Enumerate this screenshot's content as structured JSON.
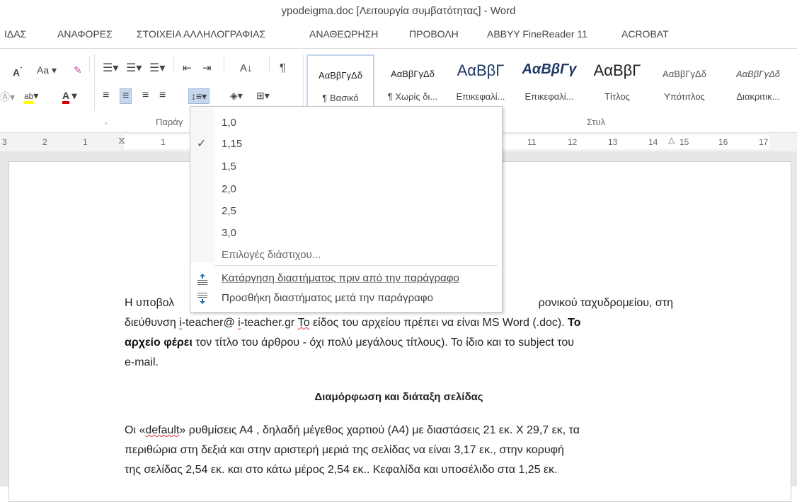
{
  "window": {
    "title": "ypodeigma.doc [Λειτουργία συμβατότητας] - Word"
  },
  "ribbon_tabs": [
    "ΙΔΑΣ",
    "ΑΝΑΦΟΡΕΣ",
    "ΣΤΟΙΧΕΙΑ ΑΛΛΗΛΟΓΡΑΦΙΑΣ",
    "ΑΝΑΘΕΩΡΗΣΗ",
    "ΠΡΟΒΟΛΗ",
    "ABBYY FineReader 11",
    "ACROBAT"
  ],
  "ribbon": {
    "font_case_label": "Aa",
    "paragraph_group_label": "Παράγ",
    "styles_group_label": "Στυλ",
    "styles": [
      {
        "sample": "ΑαΒβΓγΔδ",
        "name": "¶ Βασικό"
      },
      {
        "sample": "ΑαΒβΓγΔδ",
        "name": "¶ Χωρίς δι..."
      },
      {
        "sample": "ΑαΒβΓ",
        "name": "Επικεφαλί..."
      },
      {
        "sample": "ΑαΒβΓγ",
        "name": "Επικεφαλί..."
      },
      {
        "sample": "ΑαΒβΓ",
        "name": "Τίτλος"
      },
      {
        "sample": "ΑαΒβΓγΔδ",
        "name": "Υπότιτλος"
      },
      {
        "sample": "ΑαΒβΓγΔδ",
        "name": "Διακριτικ..."
      }
    ]
  },
  "ruler": {
    "ticks": [
      "3",
      "2",
      "1",
      "1",
      "11",
      "12",
      "13",
      "14",
      "15",
      "16",
      "17"
    ]
  },
  "line_spacing_menu": {
    "options": [
      "1,0",
      "1,15",
      "1,5",
      "2,0",
      "2,5",
      "3,0"
    ],
    "selected": "1,15",
    "more_options": "Επιλογές διάστιχου...",
    "remove_before": "Κατάργηση διαστήματος πριν από την παράγραφο",
    "add_after": "Προσθήκη διαστήματος μετά την παράγραφο"
  },
  "document": {
    "p1_line1_start": "Η υποβολ",
    "p1_line1_end": "ρονικού ταχυδρομείου, στη",
    "p1_line2_a": "διεύθυνση ",
    "p1_line2_i1": "i",
    "p1_line2_b": "-teacher@ ",
    "p1_line2_i2": "i",
    "p1_line2_c": "-teacher.gr ",
    "p1_line2_to": "Το",
    "p1_line2_d": " είδος του αρχείου πρέπει να είναι MS Word (.doc). ",
    "p1_line2_bold": "Το",
    "p1_line3_bold": "αρχείο φέρει",
    "p1_line3_rest": " τον τίτλο του άρθρου - όχι πολύ μεγάλους τίτλους). Το ίδιο και το subject του",
    "p1_line4": "e-mail.",
    "heading": "Διαμόρφωση και διάταξη σελίδας",
    "p2_line1_a": "Οι «",
    "p2_line1_default": "default",
    "p2_line1_b": "» ρυθμίσεις Α4 , δηλαδή μέγεθος χαρτιού (Α4) με διαστάσεις 21 εκ. Χ 29,7 εκ, τα",
    "p2_line2": "περιθώρια στη δεξιά και στην αριστερή μεριά της σελίδας να είναι 3,17 εκ., στην κορυφή",
    "p2_line3": "της σελίδας 2,54 εκ. και στο κάτω μέρος 2,54 εκ.. Κεφαλίδα και υποσέλιδο στα 1,25 εκ."
  },
  "colors": {
    "highlight": "#ffff00",
    "font_red": "#d00000",
    "selection": "#c5d7ed"
  }
}
